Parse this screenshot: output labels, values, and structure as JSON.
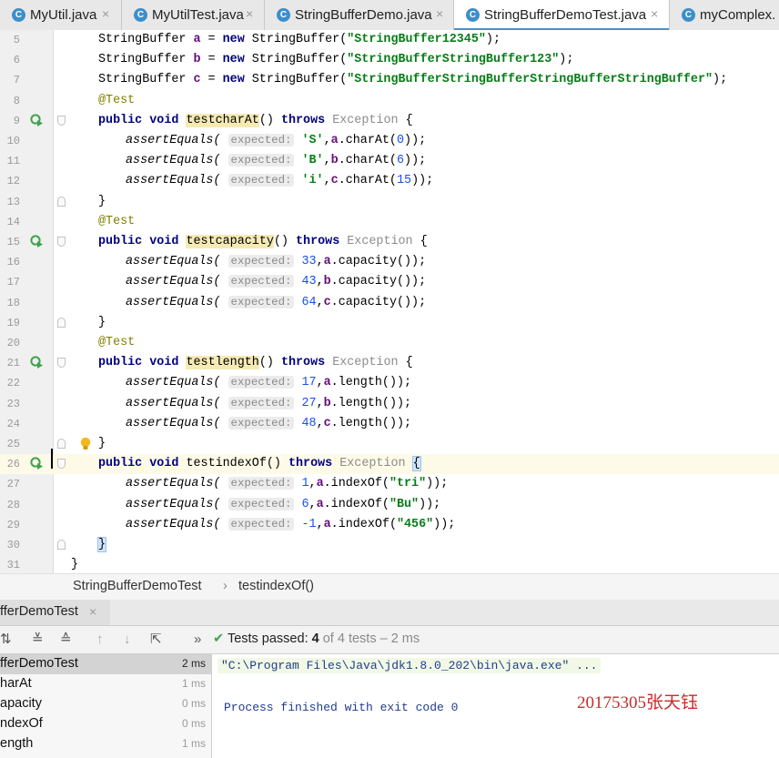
{
  "tabs": [
    {
      "name": "MyUtil.java",
      "icon": "c-class-icon",
      "active": false
    },
    {
      "name": "MyUtilTest.java",
      "icon": "c-class-icon",
      "active": false
    },
    {
      "name": "StringBufferDemo.java",
      "icon": "c-class-icon",
      "active": false
    },
    {
      "name": "StringBufferDemoTest.java",
      "icon": "c-class-icon",
      "active": true
    },
    {
      "name": "myComplex.",
      "icon": "c-class-icon",
      "active": false
    }
  ],
  "tab_close_glyph": "×",
  "code": {
    "lines": {
      "5": {
        "num": "5",
        "t1": "StringBuffer ",
        "v": "a",
        "t2": " = ",
        "kw": "new",
        "t3": " StringBuffer(",
        "s": "\"StringBuffer12345\"",
        "t4": ");"
      },
      "6": {
        "num": "6",
        "t1": "StringBuffer ",
        "v": "b",
        "t2": " = ",
        "kw": "new",
        "t3": " StringBuffer(",
        "s": "\"StringBufferStringBuffer123\"",
        "t4": ");"
      },
      "7": {
        "num": "7",
        "t1": "StringBuffer ",
        "v": "c",
        "t2": " = ",
        "kw": "new",
        "t3": " StringBuffer(",
        "s": "\"StringBufferStringBufferStringBufferStringBuffer\"",
        "t4": ");"
      },
      "8": {
        "num": "8",
        "ann": "@Test"
      },
      "9": {
        "num": "9",
        "kw1": "public",
        "kw2": "void",
        "method": "testcharAt",
        "after": "() ",
        "kw3": "throws",
        "exc": " Exception ",
        "brace": "{"
      },
      "10": {
        "num": "10",
        "call": "assertEquals(",
        "hint": "expected:",
        "val": "'S'",
        "comma": ",",
        "obj": "a",
        "rest": ".charAt(",
        "arg": "0",
        "end": "));"
      },
      "11": {
        "num": "11",
        "call": "assertEquals(",
        "hint": "expected:",
        "val": "'B'",
        "comma": ",",
        "obj": "b",
        "rest": ".charAt(",
        "arg": "6",
        "end": "));"
      },
      "12": {
        "num": "12",
        "call": "assertEquals(",
        "hint": "expected:",
        "val": "'i'",
        "comma": ",",
        "obj": "c",
        "rest": ".charAt(",
        "arg": "15",
        "end": "));"
      },
      "13": {
        "num": "13",
        "brace": "}"
      },
      "14": {
        "num": "14",
        "ann": "@Test"
      },
      "15": {
        "num": "15",
        "kw1": "public",
        "kw2": "void",
        "method": "testcapacity",
        "after": "() ",
        "kw3": "throws",
        "exc": " Exception ",
        "brace": "{"
      },
      "16": {
        "num": "16",
        "call": "assertEquals(",
        "hint": "expected:",
        "val": "33",
        "comma": ",",
        "obj": "a",
        "rest": ".capacity());"
      },
      "17": {
        "num": "17",
        "call": "assertEquals(",
        "hint": "expected:",
        "val": "43",
        "comma": ",",
        "obj": "b",
        "rest": ".capacity());"
      },
      "18": {
        "num": "18",
        "call": "assertEquals(",
        "hint": "expected:",
        "val": "64",
        "comma": ",",
        "obj": "c",
        "rest": ".capacity());"
      },
      "19": {
        "num": "19",
        "brace": "}"
      },
      "20": {
        "num": "20",
        "ann": "@Test"
      },
      "21": {
        "num": "21",
        "kw1": "public",
        "kw2": "void",
        "method": "testlength",
        "after": "() ",
        "kw3": "throws",
        "exc": " Exception ",
        "brace": "{"
      },
      "22": {
        "num": "22",
        "call": "assertEquals(",
        "hint": "expected:",
        "val": "17",
        "comma": ",",
        "obj": "a",
        "rest": ".length());"
      },
      "23": {
        "num": "23",
        "call": "assertEquals(",
        "hint": "expected:",
        "val": "27",
        "comma": ",",
        "obj": "b",
        "rest": ".length());"
      },
      "24": {
        "num": "24",
        "call": "assertEquals(",
        "hint": "expected:",
        "val": "48",
        "comma": ",",
        "obj": "c",
        "rest": ".length());"
      },
      "25": {
        "num": "25",
        "brace": "}"
      },
      "26": {
        "num": "26",
        "kw1": "public",
        "kw2": "void",
        "method": "testindexOf",
        "after": "() ",
        "kw3": "throws",
        "exc": " Exception ",
        "brace": "{"
      },
      "27": {
        "num": "27",
        "call": "assertEquals(",
        "hint": "expected:",
        "val": "1",
        "comma": ",",
        "obj": "a",
        "rest": ".indexOf(",
        "arg": "\"tri\"",
        "end": "));"
      },
      "28": {
        "num": "28",
        "call": "assertEquals(",
        "hint": "expected:",
        "val": "6",
        "comma": ",",
        "obj": "a",
        "rest": ".indexOf(",
        "arg": "\"Bu\"",
        "end": "));"
      },
      "29": {
        "num": "29",
        "call": "assertEquals(",
        "hint": "expected:",
        "val": "-1",
        "comma": ",",
        "obj": "a",
        "rest": ".indexOf(",
        "arg": "\"456\"",
        "end": "));"
      },
      "30": {
        "num": "30",
        "brace": "}"
      },
      "31": {
        "num": "31",
        "brace": "}"
      }
    }
  },
  "breadcrumb": {
    "class": "StringBufferDemoTest",
    "separator": "›",
    "method": "testindexOf()"
  },
  "run_panel": {
    "tab_label": "fferDemoTest",
    "tab_close": "×",
    "toolbar_glyphs": {
      "sort": "⇅",
      "expand": "≚",
      "collapse": "≙",
      "up": "↑",
      "down": "↓",
      "export": "⇱",
      "more": "»"
    },
    "status": {
      "check": "✔",
      "prefix": "Tests passed: ",
      "passed": "4",
      "of": "of 4 tests",
      "dash": " – ",
      "duration": "2 ms"
    },
    "tree": [
      {
        "name": "fferDemoTest",
        "time": "2 ms",
        "selected": true
      },
      {
        "name": "harAt",
        "time": "1 ms",
        "selected": false
      },
      {
        "name": "apacity",
        "time": "0 ms",
        "selected": false
      },
      {
        "name": "ndexOf",
        "time": "0 ms",
        "selected": false
      },
      {
        "name": "ength",
        "time": "1 ms",
        "selected": false
      }
    ],
    "console": {
      "command": "\"C:\\Program Files\\Java\\jdk1.8.0_202\\bin\\java.exe\" ...",
      "exit": "Process finished with exit code 0"
    }
  },
  "watermark": "20175305张天钰",
  "colors": {
    "accent": "#4b8fc8",
    "run_green": "#3fa34d",
    "keyword": "#000080",
    "string": "#067d17",
    "number": "#1750eb",
    "annotation": "#808000",
    "field": "#660e7a",
    "error_red": "#cc2a2a"
  }
}
